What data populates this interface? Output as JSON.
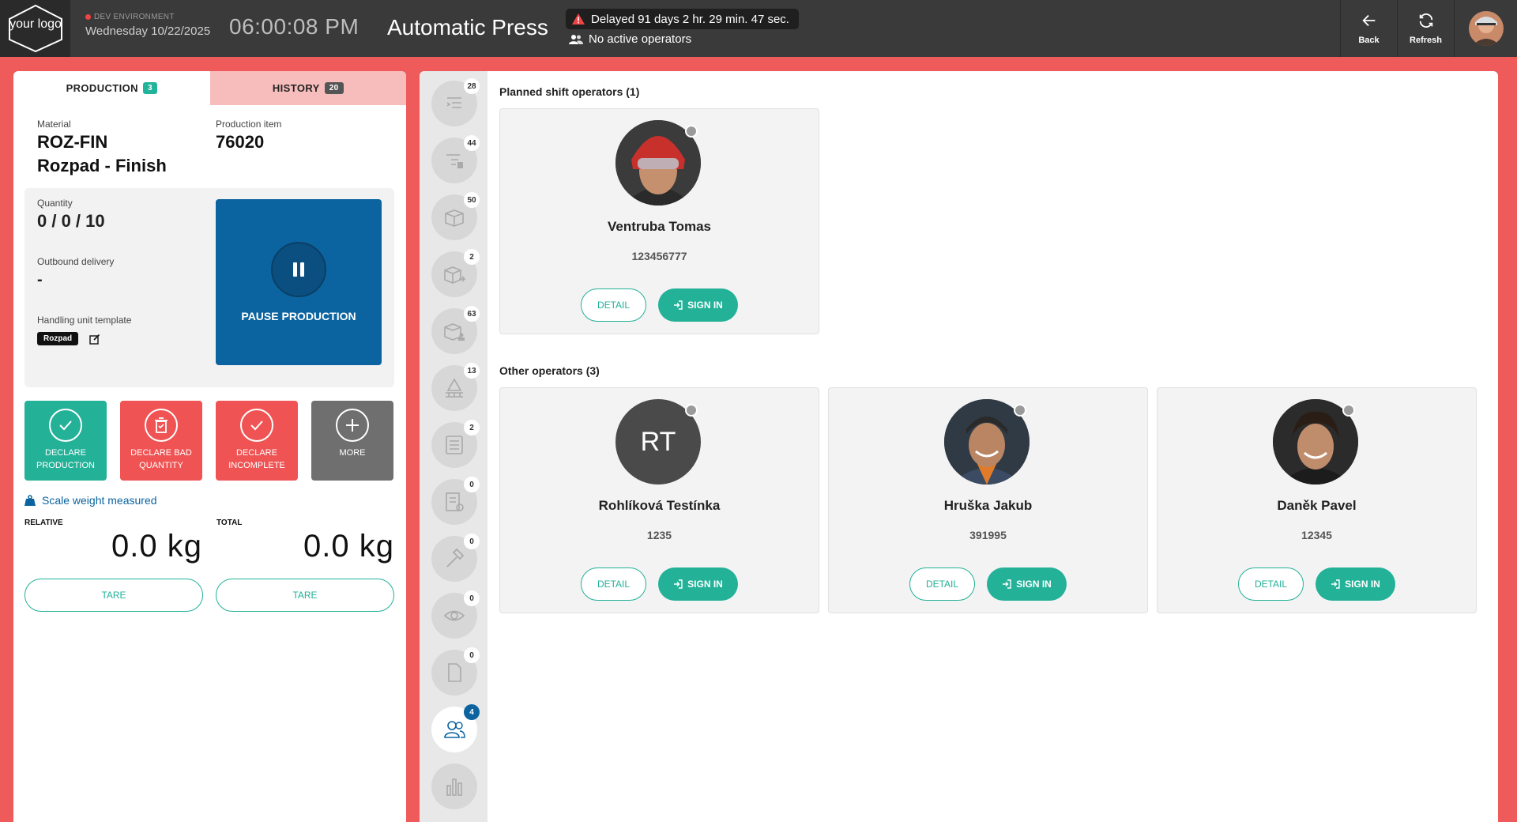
{
  "header": {
    "logo_text": "your logo",
    "env_label": "DEV ENVIRONMENT",
    "date": "Wednesday 10/22/2025",
    "clock": "06:00:08 PM",
    "machine": "Automatic Press",
    "delay": "Delayed 91 days 2 hr. 29 min. 47 sec.",
    "operators_status": "No active operators",
    "back_label": "Back",
    "refresh_label": "Refresh"
  },
  "left": {
    "tabs": [
      {
        "label": "PRODUCTION",
        "count": "3"
      },
      {
        "label": "HISTORY",
        "count": "20"
      }
    ],
    "material_label": "Material",
    "material_code": "ROZ-FIN",
    "material_name": "Rozpad - Finish",
    "production_item_label": "Production item",
    "production_item": "76020",
    "quantity_label": "Quantity",
    "quantity": "0 / 0 / 10",
    "outbound_label": "Outbound delivery",
    "outbound": "-",
    "hut_label": "Handling unit template",
    "hut_tag": "Rozpad",
    "pause_label": "PAUSE PRODUCTION",
    "actions": [
      {
        "label1": "DECLARE",
        "label2": "PRODUCTION"
      },
      {
        "label1": "DECLARE BAD",
        "label2": "QUANTITY"
      },
      {
        "label1": "DECLARE",
        "label2": "INCOMPLETE"
      },
      {
        "label1": "MORE",
        "label2": ""
      }
    ],
    "scale_text": "Scale weight measured",
    "relative_label": "RELATIVE",
    "relative_value": "0.0 kg",
    "total_label": "TOTAL",
    "total_value": "0.0 kg",
    "tare_label": "TARE"
  },
  "rail": {
    "badges": [
      "28",
      "44",
      "50",
      "2",
      "63",
      "13",
      "2",
      "0",
      "0",
      "0",
      "0",
      "4",
      ""
    ]
  },
  "operators": {
    "planned_title": "Planned shift operators (1)",
    "other_title": "Other operators (3)",
    "detail_label": "DETAIL",
    "sign_in_label": "SIGN IN",
    "planned": [
      {
        "name": "Ventruba Tomas",
        "id": "123456777"
      }
    ],
    "other": [
      {
        "name": "Rohlíková Testínka",
        "id": "1235",
        "initials": "RT"
      },
      {
        "name": "Hruška Jakub",
        "id": "391995"
      },
      {
        "name": "Daněk Pavel",
        "id": "12345"
      }
    ]
  },
  "colors": {
    "accent_green": "#23b198",
    "accent_red": "#ef5353",
    "primary_blue": "#0b64a0",
    "topbar": "#3a3a3a",
    "frame_red": "#ef5b5b"
  }
}
